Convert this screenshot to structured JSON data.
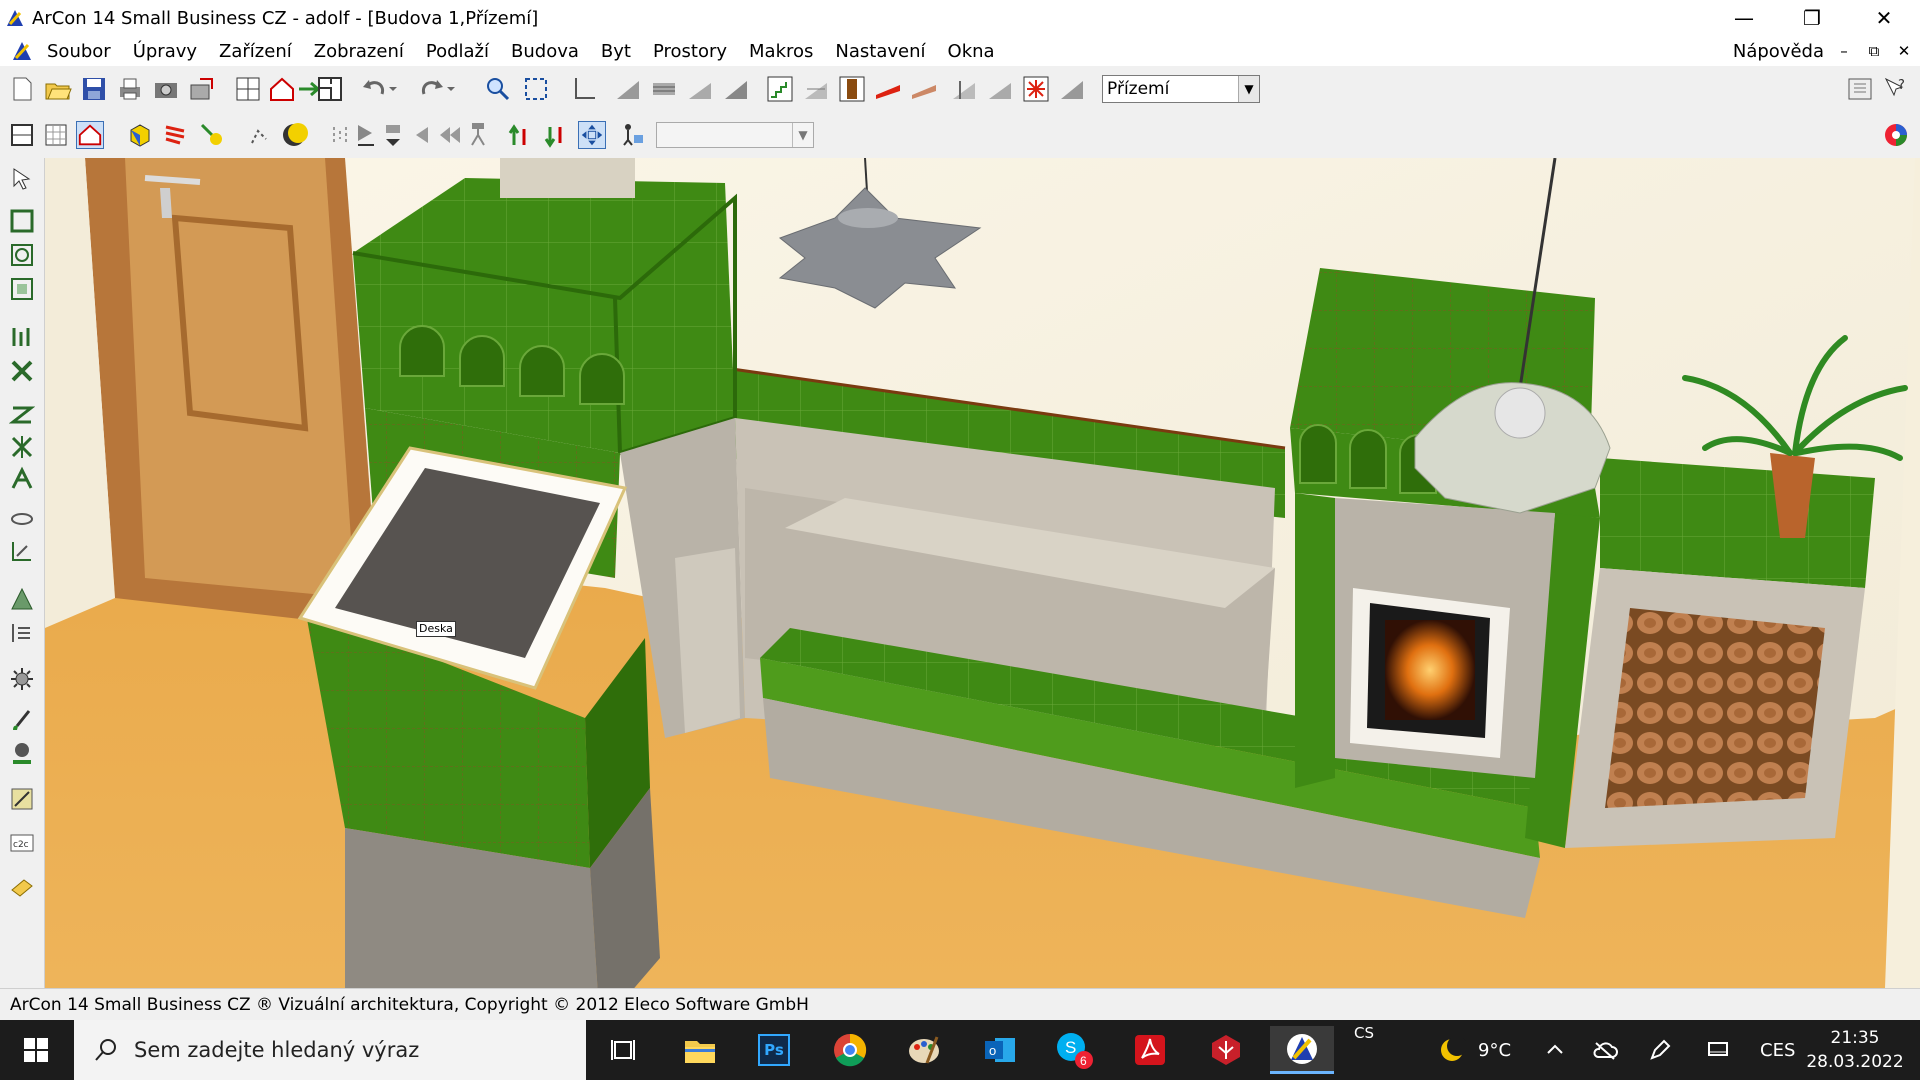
{
  "window": {
    "title": "ArCon 14 Small Business CZ - adolf - [Budova 1,Přízemí]",
    "minimize": "—",
    "maximize": "❐",
    "close": "✕"
  },
  "menu": {
    "items": [
      "Soubor",
      "Úpravy",
      "Zařízení",
      "Zobrazení",
      "Podlaží",
      "Budova",
      "Byt",
      "Prostory",
      "Makros",
      "Nastavení",
      "Okna"
    ],
    "help": "Nápověda",
    "mdi": [
      "–",
      "⧉",
      "✕"
    ]
  },
  "toolbar": {
    "floor_select": "Přízemí",
    "view_select": ""
  },
  "viewport": {
    "tooltip": "Deska"
  },
  "statusbar": {
    "text": "ArCon 14 Small Business CZ ® Vizuální architektura, Copyright © 2012 Eleco Software GmbH"
  },
  "taskbar": {
    "search_placeholder": "Sem zadejte hledaný výraz",
    "apps": [
      "task-view",
      "file-explorer",
      "photoshop",
      "chrome",
      "paint-palette",
      "outlook",
      "skype",
      "acrobat",
      "app-red",
      "arcon"
    ],
    "skype_badge": "6",
    "ps_label": "Ps",
    "outlook_label": "o",
    "skype_label": "S",
    "lang_small": "CS",
    "weather": "9°C",
    "input_lang": "CES",
    "time": "21:35",
    "date": "28.03.2022"
  },
  "colors": {
    "tile_green": "#3f8a14",
    "wall": "#f6f0e0",
    "floor": "#e9a94a",
    "taskbar": "#1c1c1c"
  }
}
